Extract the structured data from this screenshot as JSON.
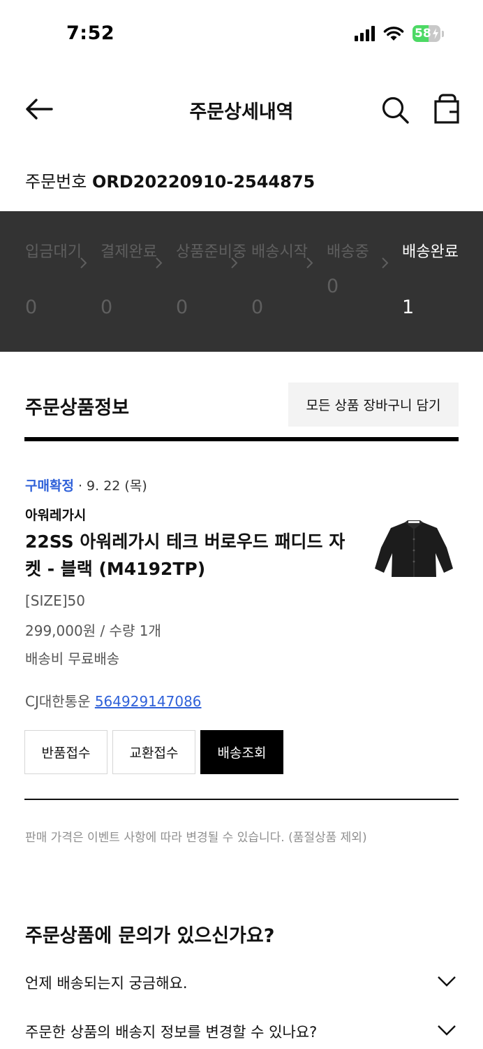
{
  "status_bar": {
    "time": "7:52",
    "battery_level": "58",
    "icons": [
      "signal-icon",
      "wifi-icon",
      "battery-charging-icon"
    ]
  },
  "header": {
    "title": "주문상세내역",
    "icons": [
      "back-arrow-icon",
      "search-icon",
      "shopping-bag-icon"
    ]
  },
  "order": {
    "number_label": "주문번호",
    "number": "ORD20220910-2544875"
  },
  "progress": {
    "steps": [
      {
        "label": "입금대기",
        "count": "0",
        "active": false
      },
      {
        "label": "결제완료",
        "count": "0",
        "active": false
      },
      {
        "label": "상품준비중",
        "count": "0",
        "active": false
      },
      {
        "label": "배송시작",
        "count": "0",
        "active": false
      },
      {
        "label": "배송중",
        "count": "0",
        "active": false
      },
      {
        "label": "배송완료",
        "count": "1",
        "active": true
      }
    ],
    "colors": {
      "band": "#333333",
      "inactive": "#5f5f5f",
      "active": "#ffffff"
    }
  },
  "products": {
    "section_title": "주문상품정보",
    "add_all_to_cart": "모든 상품 장바구니 담기",
    "item": {
      "status": "구매확정",
      "date": "· 9. 22 (목)",
      "brand": "아워레가시",
      "name": "22SS 아워레가시 테크 버로우드 패디드 자켓 - 블랙 (M4192TP)",
      "option": "[SIZE]50",
      "price_qty": "299,000원 / 수량 1개",
      "shipping_fee": "배송비 무료배송",
      "courier": "CJ대한통운",
      "tracking_number": "564929147086",
      "buttons": {
        "return": "반품접수",
        "exchange": "교환접수",
        "track": "배송조회"
      }
    },
    "price_notice": "판매 가격은 이벤트 사항에 따라 변경될 수 있습니다. (품절상품 제외)"
  },
  "faq": {
    "title": "주문상품에 문의가 있으신가요?",
    "items": [
      "언제 배송되는지 궁금해요.",
      "주문한 상품의 배송지 정보를 변경할 수 있나요?"
    ]
  },
  "colors": {
    "accent_blue": "#2f61d9",
    "primary_black": "#000000"
  }
}
